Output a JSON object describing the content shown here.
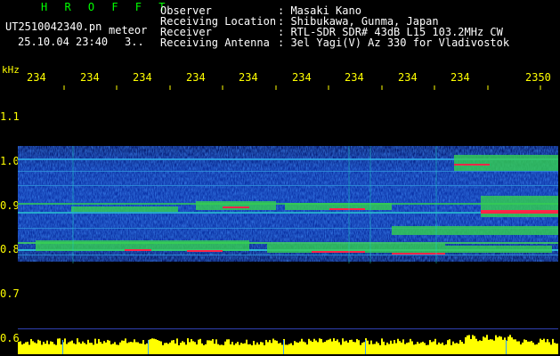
{
  "header": {
    "logo": "H R O F F T",
    "filename": "UT2510042340.pn",
    "filename_suffix": "meteor",
    "datetime": "25.10.04 23:40",
    "page": "3..",
    "observer_label": "Observer",
    "observer_value": ": Masaki Kano",
    "location_label": "Receiving Location",
    "location_value": ": Shibukawa, Gunma, Japan",
    "receiver_label": "Receiver",
    "receiver_value": ": RTL-SDR SDR# 43dB L15 103.2MHz CW",
    "antenna_label": "Receiving Antenna",
    "antenna_value": ": 3el Yagi(V) Az 330 for Vladivostok"
  },
  "axes": {
    "y_unit": "kHz",
    "x_ticks": [
      "234",
      "234",
      "234",
      "234",
      "234",
      "234",
      "234",
      "234",
      "234",
      "2350"
    ],
    "y_ticks": [
      "1.1",
      "1.0",
      "0.9",
      "0.8",
      "0.7",
      "0.6"
    ]
  },
  "colors": {
    "background": "#000000",
    "signal_band": "#1a3aa0",
    "echo_green": "#28c840",
    "echo_red": "#ff2040",
    "noise_floor": "#ffff00",
    "tick_text": "#ffff00"
  }
}
